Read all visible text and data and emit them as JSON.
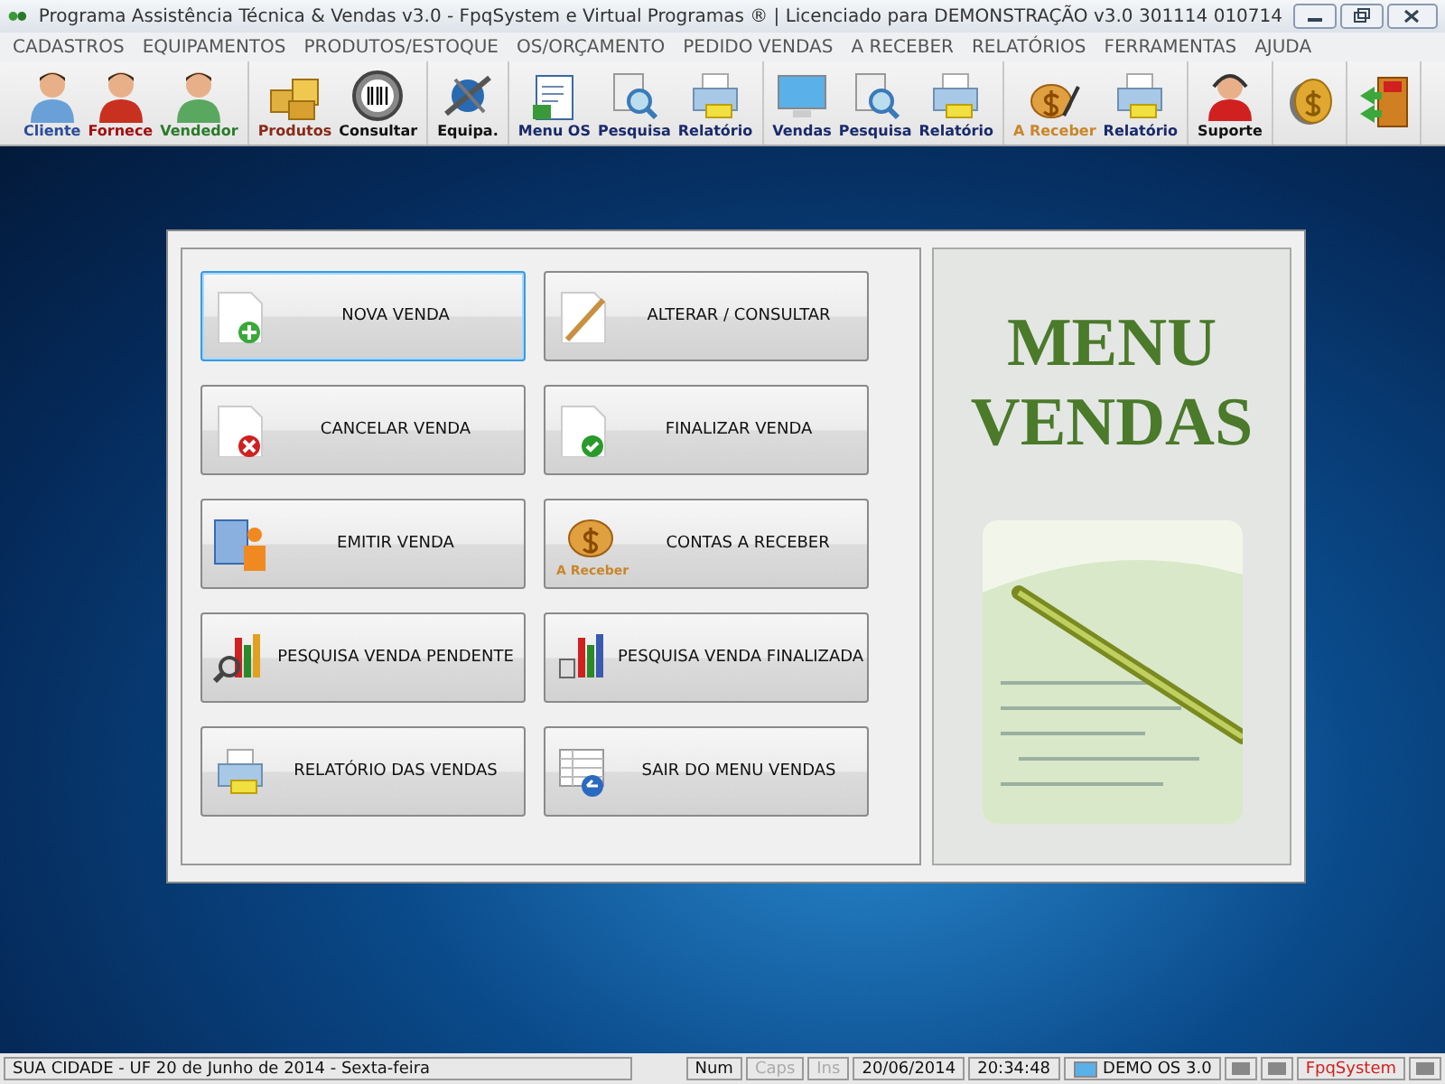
{
  "window": {
    "title": "Programa Assistência Técnica & Vendas v3.0 - FpqSystem e Virtual Programas ® | Licenciado para  DEMONSTRAÇÃO v3.0 301114 010714"
  },
  "menu": [
    "CADASTROS",
    "EQUIPAMENTOS",
    "PRODUTOS/ESTOQUE",
    "OS/ORÇAMENTO",
    "PEDIDO VENDAS",
    "A RECEBER",
    "RELATÓRIOS",
    "FERRAMENTAS",
    "AJUDA"
  ],
  "toolbar": [
    {
      "items": [
        {
          "kind": "labeled",
          "label": "Cliente",
          "color": "#2a4a9a"
        },
        {
          "kind": "labeled",
          "label": "Fornece",
          "color": "#a01010"
        },
        {
          "kind": "labeled",
          "label": "Vendedor",
          "color": "#2a7a2a"
        }
      ]
    },
    {
      "items": [
        {
          "kind": "labeled",
          "label": "Produtos",
          "color": "#8a2a1a"
        },
        {
          "kind": "labeled",
          "label": "Consultar",
          "color": "#111111"
        }
      ]
    },
    {
      "items": [
        {
          "kind": "labeled",
          "label": "Equipa.",
          "color": "#111111"
        }
      ]
    },
    {
      "items": [
        {
          "kind": "labeled",
          "label": "Menu OS",
          "color": "#1a2a6a"
        },
        {
          "kind": "labeled",
          "label": "Pesquisa",
          "color": "#1a2a6a"
        },
        {
          "kind": "labeled",
          "label": "Relatório",
          "color": "#1a2a6a"
        }
      ]
    },
    {
      "items": [
        {
          "kind": "labeled",
          "label": "Vendas",
          "color": "#1a2a6a"
        },
        {
          "kind": "labeled",
          "label": "Pesquisa",
          "color": "#1a2a6a"
        },
        {
          "kind": "labeled",
          "label": "Relatório",
          "color": "#1a2a6a"
        }
      ]
    },
    {
      "items": [
        {
          "kind": "labeled",
          "label": "A Receber",
          "color": "#c8862a"
        },
        {
          "kind": "labeled",
          "label": "Relatório",
          "color": "#1a2a6a"
        }
      ]
    },
    {
      "items": [
        {
          "kind": "labeled",
          "label": "Suporte",
          "color": "#111111"
        }
      ]
    },
    {
      "items": [
        {
          "kind": "icon"
        }
      ]
    },
    {
      "items": [
        {
          "kind": "icon"
        }
      ]
    }
  ],
  "buttons": [
    {
      "label": "NOVA VENDA",
      "focused": true
    },
    {
      "label": "ALTERAR / CONSULTAR",
      "focused": false
    },
    {
      "label": "CANCELAR VENDA",
      "focused": false
    },
    {
      "label": "FINALIZAR VENDA",
      "focused": false
    },
    {
      "label": "EMITIR VENDA",
      "focused": false
    },
    {
      "label": "CONTAS  A  RECEBER",
      "focused": false,
      "icon_caption": "A Receber"
    },
    {
      "label": "PESQUISA VENDA PENDENTE",
      "focused": false
    },
    {
      "label": "PESQUISA VENDA FINALIZADA",
      "focused": false
    },
    {
      "label": "RELATÓRIO DAS VENDAS",
      "focused": false
    },
    {
      "label": "SAIR DO MENU VENDAS",
      "focused": false
    }
  ],
  "side_panel": {
    "title_lines": [
      "MENU",
      "VENDAS"
    ]
  },
  "status_bar": [
    {
      "kind": "text",
      "text": "SUA CIDADE - UF 20 de Junho de 2014 - Sexta-feira",
      "disabled": false
    },
    {
      "kind": "text",
      "text": "Num",
      "disabled": false
    },
    {
      "kind": "text",
      "text": "Caps",
      "disabled": true
    },
    {
      "kind": "text",
      "text": "Ins",
      "disabled": true
    },
    {
      "kind": "text",
      "text": "20/06/2014",
      "disabled": false
    },
    {
      "kind": "text",
      "text": "20:34:48",
      "disabled": false
    },
    {
      "kind": "icontext",
      "text": "DEMO OS 3.0",
      "disabled": false
    },
    {
      "kind": "icon"
    },
    {
      "kind": "icon"
    },
    {
      "kind": "brand",
      "text": "FpqSystem",
      "disabled": false
    },
    {
      "kind": "icon"
    }
  ]
}
